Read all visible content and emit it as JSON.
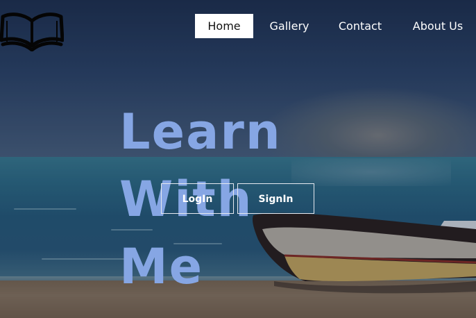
{
  "nav": {
    "items": [
      {
        "label": "Home",
        "active": true
      },
      {
        "label": "Gallery",
        "active": false
      },
      {
        "label": "Contact",
        "active": false
      },
      {
        "label": "About Us",
        "active": false
      }
    ]
  },
  "hero": {
    "title_line1": "Learn",
    "title_line2": "With Me",
    "login_label": "LogIn",
    "signin_label": "SignIn"
  },
  "logo": {
    "icon": "open-book-icon"
  },
  "colors": {
    "title": "#86a6e4",
    "active_nav_bg": "#ffffff",
    "button_border": "#e6e9ef"
  }
}
